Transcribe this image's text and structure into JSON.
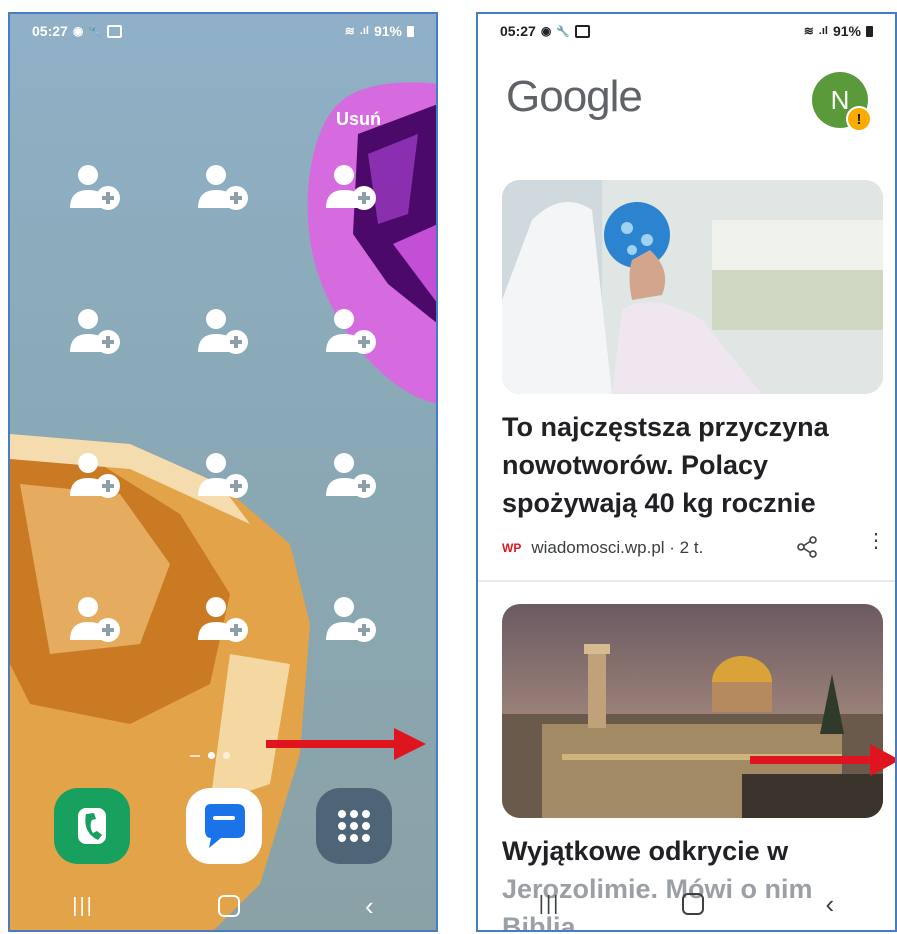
{
  "left": {
    "status": {
      "time": "05:27",
      "battery": "91%"
    },
    "remove_label": "Usuń",
    "page_dots": 3,
    "contact_widgets": 12,
    "dock": [
      {
        "name": "phone",
        "color": "#17a05e"
      },
      {
        "name": "messages",
        "color": "#ffffff"
      },
      {
        "name": "apps",
        "color": "#4e6578"
      }
    ]
  },
  "right": {
    "status": {
      "time": "05:27",
      "battery": "91%"
    },
    "logo": "Google",
    "avatar": {
      "letter": "N",
      "color": "#5b9a3a"
    },
    "articles": [
      {
        "title_lines": [
          "To najczęstsza przyczyna",
          "nowotworów. Polacy",
          "spożywają 40 kg rocznie"
        ],
        "source": "wiadomosci.wp.pl · 2 t."
      },
      {
        "title_lines": [
          "Wyjątkowe odkrycie w",
          "Jerozolimie. Mówi o nim",
          "Biblia"
        ]
      }
    ]
  },
  "colors": {
    "arrow": "#e0141e",
    "panel_border": "#4a7cc4"
  }
}
